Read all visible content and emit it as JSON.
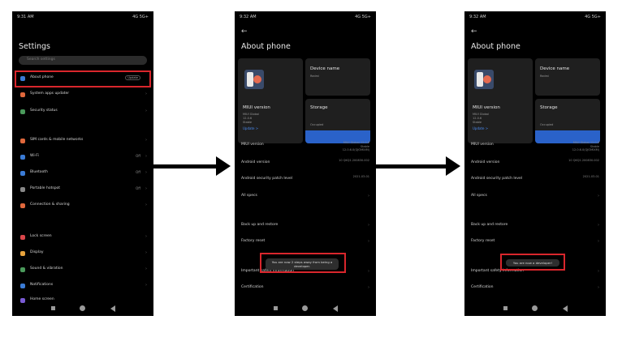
{
  "status_bar": {
    "time1": "9:31 AM",
    "time2": "9:32 AM",
    "time3": "9:32 AM",
    "right": "4G 5G+"
  },
  "phone1": {
    "title": "Settings",
    "search_placeholder": "Search settings",
    "items": [
      {
        "label": "About phone",
        "badge": "Update",
        "icon": "phone-icon"
      },
      {
        "label": "System apps updater",
        "icon": "update-icon"
      },
      {
        "label": "Security status",
        "icon": "shield-icon"
      },
      {
        "label": "SIM cards & mobile networks",
        "icon": "sim-icon"
      },
      {
        "label": "Wi-Fi",
        "value": "Off",
        "icon": "wifi-icon"
      },
      {
        "label": "Bluetooth",
        "value": "Off",
        "icon": "bluetooth-icon"
      },
      {
        "label": "Portable hotspot",
        "value": "Off",
        "icon": "hotspot-icon"
      },
      {
        "label": "Connection & sharing",
        "icon": "sharing-icon"
      },
      {
        "label": "Lock screen",
        "icon": "lock-icon"
      },
      {
        "label": "Display",
        "icon": "display-icon"
      },
      {
        "label": "Sound & vibration",
        "icon": "sound-icon"
      },
      {
        "label": "Notifications",
        "icon": "notification-icon"
      },
      {
        "label": "Home screen",
        "icon": "home-icon"
      }
    ]
  },
  "about": {
    "title": "About phone",
    "miui_card": {
      "title": "MIUI version",
      "line1": "MIUI Global",
      "line2": "12.0.6",
      "line3": "Stable",
      "update": "Update >"
    },
    "device_card": {
      "title": "Device name",
      "value": "Redmi"
    },
    "storage_card": {
      "title": "Storage",
      "used": "Occupied"
    },
    "rows": [
      {
        "label": "MIUI version",
        "value": "MIUI Global 12.0.6 Stable 12.0.6.0(QJOMIXM)"
      },
      {
        "label": "Android version",
        "value": "10 QKQ1.200830.002"
      },
      {
        "label": "Android security patch level",
        "value": "2021-03-01"
      },
      {
        "label": "All specs"
      },
      {
        "label": "Back up and restore"
      },
      {
        "label": "Factory reset"
      },
      {
        "label": "Important safety information"
      },
      {
        "label": "Certification"
      }
    ]
  },
  "toast2": "You are now 2 steps away from being a developer.",
  "toast3": "You are now a developer!"
}
